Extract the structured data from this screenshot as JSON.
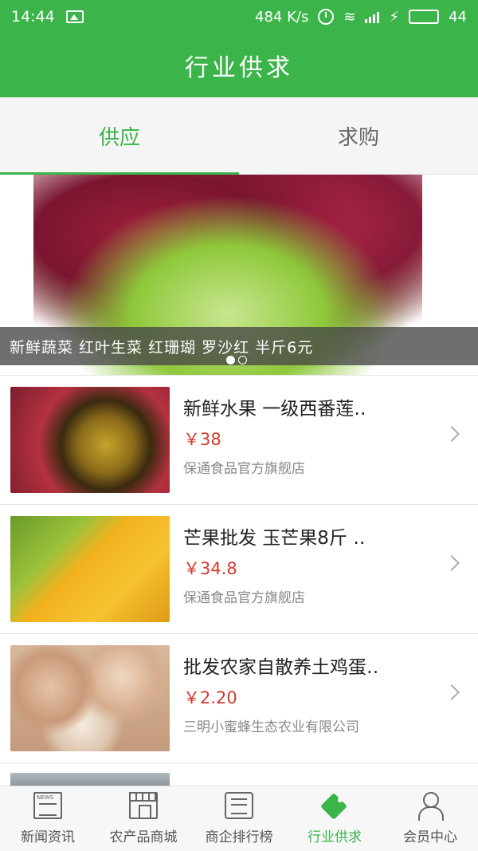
{
  "status_bar": {
    "time": "14:44",
    "net_speed": "484 K/s",
    "battery_level": "44"
  },
  "header": {
    "title": "行业供求"
  },
  "tabs": [
    {
      "label": "供应",
      "active": true
    },
    {
      "label": "求购",
      "active": false
    }
  ],
  "banner": {
    "caption": "新鲜蔬菜 红叶生菜 红珊瑚 罗沙红 半斤6元",
    "page_count": 2,
    "current_page": 1
  },
  "products": [
    {
      "title": "新鲜水果 一级西番莲‥",
      "price": "￥38",
      "shop": "保通食品官方旗舰店"
    },
    {
      "title": "芒果批发 玉芒果8斤 ‥",
      "price": "￥34.8",
      "shop": "保通食品官方旗舰店"
    },
    {
      "title": "批发农家自散养土鸡蛋‥",
      "price": "￥2.20",
      "shop": "三明小蜜蜂生态农业有限公司"
    }
  ],
  "bottom_nav": [
    {
      "label": "新闻资讯",
      "icon": "news-icon",
      "active": false
    },
    {
      "label": "农产品商城",
      "icon": "shop-icon",
      "active": false
    },
    {
      "label": "商企排行榜",
      "icon": "rank-icon",
      "active": false
    },
    {
      "label": "行业供求",
      "icon": "tag-icon",
      "active": true
    },
    {
      "label": "会员中心",
      "icon": "user-icon",
      "active": false
    }
  ],
  "colors": {
    "accent": "#3bb54a",
    "price": "#d23a2e"
  }
}
